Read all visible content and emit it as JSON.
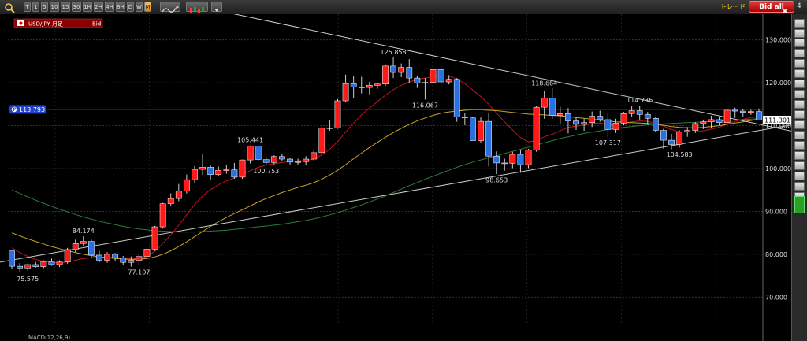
{
  "toolbar": {
    "timeframes": [
      "T",
      "1",
      "5",
      "10",
      "15",
      "30",
      "1H",
      "2H",
      "4H",
      "8H",
      "D",
      "W",
      "M"
    ],
    "active_timeframe": "M",
    "bid_all_label": "Bid all",
    "trend_label": "トレード",
    "side_number": "4"
  },
  "symbol_label": "USD/JPY 月足",
  "price_side": "Bid",
  "bottom_label": "MACD(12,26,9)",
  "colors": {
    "up": "#ff1a1a",
    "down": "#2b6fe0",
    "grid": "#3a3a3a",
    "ma_red": "#c0151d",
    "ma_orange": "#e6a420",
    "ma_green": "#2d7a3a",
    "ma_olive": "#a0a030",
    "trendline": "#cccccc"
  },
  "chart_data": {
    "type": "candlestick",
    "ylim": [
      64,
      136
    ],
    "y_ticks": [
      130,
      120,
      110,
      100,
      90,
      80,
      70
    ],
    "y_tick_labels": [
      "130.000",
      "120.000",
      "110.000",
      "100.000",
      "90.000",
      "80.000",
      "70.000"
    ],
    "current_price_label": "113.793",
    "last_price_label": "111.301",
    "candles": [
      [
        80.8,
        80.8,
        76.5,
        77.2
      ],
      [
        77.2,
        78.0,
        76.0,
        76.8
      ],
      [
        76.8,
        77.9,
        76.2,
        77.6
      ],
      [
        77.6,
        78.2,
        76.9,
        77.1
      ],
      [
        77.1,
        78.6,
        76.8,
        78.3
      ],
      [
        78.3,
        79.0,
        77.3,
        77.6
      ],
      [
        77.6,
        78.6,
        77.0,
        78.2
      ],
      [
        78.2,
        81.5,
        77.8,
        81.1
      ],
      [
        81.1,
        83.4,
        80.5,
        82.5
      ],
      [
        82.5,
        84.2,
        81.9,
        83.0
      ],
      [
        83.0,
        83.4,
        79.2,
        79.8
      ],
      [
        79.8,
        80.8,
        78.1,
        78.6
      ],
      [
        78.6,
        80.5,
        78.0,
        80.0
      ],
      [
        80.0,
        80.3,
        78.5,
        79.1
      ],
      [
        79.1,
        79.6,
        77.4,
        78.1
      ],
      [
        78.1,
        79.5,
        77.1,
        78.6
      ],
      [
        78.6,
        80.1,
        77.5,
        79.5
      ],
      [
        79.5,
        81.9,
        79.0,
        81.2
      ],
      [
        81.2,
        86.6,
        80.8,
        86.4
      ],
      [
        86.4,
        92.0,
        86.0,
        91.8
      ],
      [
        91.8,
        94.2,
        91.3,
        93.0
      ],
      [
        93.0,
        96.4,
        92.4,
        94.8
      ],
      [
        94.8,
        98.6,
        94.2,
        97.4
      ],
      [
        97.4,
        100.6,
        96.7,
        99.8
      ],
      [
        99.8,
        103.5,
        98.5,
        100.3
      ],
      [
        100.3,
        100.7,
        97.4,
        98.6
      ],
      [
        98.6,
        100.5,
        98.3,
        99.6
      ],
      [
        99.6,
        100.9,
        98.8,
        99.7
      ],
      [
        99.7,
        101.3,
        97.6,
        98.0
      ],
      [
        98.0,
        102.1,
        97.6,
        102.0
      ],
      [
        102.0,
        105.4,
        101.2,
        105.2
      ],
      [
        105.2,
        105.4,
        101.7,
        102.1
      ],
      [
        102.1,
        102.8,
        100.8,
        101.4
      ],
      [
        101.4,
        103.1,
        101.0,
        102.8
      ],
      [
        102.8,
        103.5,
        101.8,
        102.2
      ],
      [
        102.2,
        102.5,
        100.9,
        101.5
      ],
      [
        101.5,
        102.3,
        100.9,
        101.6
      ],
      [
        101.6,
        102.9,
        100.9,
        102.2
      ],
      [
        102.2,
        104.3,
        101.8,
        103.7
      ],
      [
        103.7,
        109.8,
        103.3,
        109.4
      ],
      [
        109.4,
        111.2,
        108.8,
        109.5
      ],
      [
        109.5,
        116.2,
        109.3,
        115.8
      ],
      [
        115.8,
        121.9,
        115.5,
        119.8
      ],
      [
        119.8,
        121.6,
        116.4,
        119.0
      ],
      [
        119.0,
        121.4,
        117.5,
        118.9
      ],
      [
        118.9,
        120.2,
        117.3,
        119.4
      ],
      [
        119.4,
        120.0,
        118.6,
        119.7
      ],
      [
        119.7,
        124.3,
        119.2,
        123.9
      ],
      [
        123.9,
        125.9,
        121.1,
        122.4
      ],
      [
        122.4,
        124.5,
        121.3,
        123.6
      ],
      [
        123.6,
        125.5,
        120.0,
        121.1
      ],
      [
        121.1,
        121.7,
        118.8,
        119.9
      ],
      [
        119.9,
        121.1,
        116.1,
        120.1
      ],
      [
        120.1,
        123.6,
        119.9,
        123.1
      ],
      [
        123.1,
        123.9,
        119.0,
        120.2
      ],
      [
        120.2,
        121.8,
        119.6,
        120.8
      ],
      [
        120.8,
        121.1,
        110.9,
        112.0
      ],
      [
        112.0,
        113.0,
        110.1,
        111.8
      ],
      [
        111.8,
        112.1,
        108.3,
        106.5
      ],
      [
        106.5,
        111.9,
        106.0,
        111.0
      ],
      [
        111.0,
        112.9,
        100.5,
        102.9
      ],
      [
        102.9,
        104.0,
        98.7,
        101.3
      ],
      [
        101.3,
        102.3,
        99.5,
        101.2
      ],
      [
        101.2,
        103.9,
        100.1,
        103.3
      ],
      [
        103.3,
        104.3,
        99.0,
        100.9
      ],
      [
        100.9,
        104.6,
        100.1,
        104.3
      ],
      [
        104.3,
        114.6,
        103.9,
        114.3
      ],
      [
        114.3,
        118.0,
        111.6,
        116.4
      ],
      [
        116.4,
        118.7,
        111.6,
        112.4
      ],
      [
        112.4,
        114.4,
        110.3,
        112.8
      ],
      [
        112.8,
        114.1,
        108.2,
        111.1
      ],
      [
        111.1,
        111.9,
        109.0,
        110.3
      ],
      [
        110.3,
        111.6,
        108.8,
        110.7
      ],
      [
        110.7,
        113.3,
        109.7,
        112.2
      ],
      [
        112.2,
        113.5,
        110.9,
        111.4
      ],
      [
        111.4,
        112.8,
        107.3,
        109.1
      ],
      [
        109.1,
        111.6,
        108.3,
        110.6
      ],
      [
        110.6,
        113.2,
        110.1,
        112.8
      ],
      [
        112.8,
        114.5,
        112.0,
        113.5
      ],
      [
        113.5,
        114.7,
        111.4,
        112.6
      ],
      [
        112.6,
        113.2,
        110.2,
        111.7
      ],
      [
        111.7,
        112.0,
        108.5,
        108.9
      ],
      [
        108.9,
        109.3,
        104.6,
        106.6
      ],
      [
        106.6,
        108.1,
        104.5,
        105.6
      ],
      [
        105.6,
        108.9,
        104.9,
        108.6
      ],
      [
        108.6,
        109.7,
        107.4,
        108.9
      ],
      [
        108.9,
        110.8,
        108.3,
        110.5
      ],
      [
        110.5,
        111.4,
        109.2,
        110.9
      ],
      [
        110.9,
        112.3,
        109.5,
        111.4
      ],
      [
        111.4,
        112.0,
        110.1,
        110.7
      ],
      [
        110.7,
        113.9,
        110.4,
        113.6
      ],
      [
        113.6,
        114.2,
        111.8,
        113.4
      ],
      [
        113.4,
        113.9,
        112.0,
        113.1
      ],
      [
        113.1,
        113.7,
        112.5,
        113.3
      ],
      [
        113.3,
        114.0,
        111.6,
        111.3
      ]
    ],
    "annotations": [
      {
        "label": "75.575",
        "index": 2,
        "value": 75.575,
        "pos": "below"
      },
      {
        "label": "84.174",
        "index": 9,
        "value": 84.174,
        "pos": "above"
      },
      {
        "label": "77.107",
        "index": 16,
        "value": 77.107,
        "pos": "below"
      },
      {
        "label": "105.441",
        "index": 30,
        "value": 105.441,
        "pos": "above"
      },
      {
        "label": "100.753",
        "index": 32,
        "value": 100.753,
        "pos": "below"
      },
      {
        "label": "125.858",
        "index": 48,
        "value": 125.858,
        "pos": "above"
      },
      {
        "label": "116.067",
        "index": 52,
        "value": 116.067,
        "pos": "below"
      },
      {
        "label": "98.653",
        "index": 61,
        "value": 98.653,
        "pos": "below"
      },
      {
        "label": "118.664",
        "index": 67,
        "value": 118.664,
        "pos": "above"
      },
      {
        "label": "114.736",
        "index": 79,
        "value": 114.736,
        "pos": "above"
      },
      {
        "label": "107.317",
        "index": 75,
        "value": 107.317,
        "pos": "below"
      },
      {
        "label": "104.583",
        "index": 84,
        "value": 104.583,
        "pos": "below"
      }
    ],
    "ma_series": [
      {
        "color": "#c0151d",
        "values": [
          81.5,
          80.4,
          79.5,
          78.8,
          78.3,
          78.1,
          78.0,
          78.2,
          78.6,
          79.0,
          79.2,
          79.3,
          79.4,
          79.2,
          79.0,
          78.9,
          79.0,
          79.5,
          80.7,
          82.5,
          84.5,
          86.8,
          89.2,
          91.6,
          93.6,
          95.1,
          96.2,
          97.1,
          97.8,
          98.6,
          99.5,
          100.3,
          100.8,
          101.1,
          101.4,
          101.6,
          101.8,
          101.9,
          102.2,
          103.2,
          104.5,
          106.3,
          108.5,
          110.6,
          112.5,
          114.1,
          115.6,
          117.1,
          118.4,
          119.4,
          120.2,
          120.8,
          121.1,
          121.4,
          121.6,
          121.6,
          120.9,
          119.8,
          118.3,
          116.8,
          115.0,
          112.9,
          110.9,
          109.0,
          107.2,
          106.2,
          106.5,
          107.4,
          108.0,
          108.8,
          109.6,
          109.9,
          110.1,
          110.5,
          110.6,
          110.3,
          110.2,
          110.5,
          110.9,
          111.1,
          111.0,
          110.6,
          109.9,
          109.1,
          108.6,
          108.5,
          108.6,
          108.8,
          109.2,
          109.6,
          110.4,
          111.0,
          111.5,
          111.9,
          112.1
        ]
      },
      {
        "color": "#e6a420",
        "values": [
          null,
          null,
          null,
          null,
          null,
          null,
          null,
          null,
          null,
          null,
          null,
          null,
          null,
          null,
          null,
          null,
          null,
          null,
          null,
          null,
          null,
          null,
          null,
          null,
          null,
          null,
          null,
          null,
          null,
          null,
          null,
          null,
          null,
          null,
          null,
          null,
          null,
          null,
          null,
          null,
          null,
          null,
          null,
          null,
          null,
          null,
          null,
          null,
          null,
          null,
          null,
          null,
          null,
          null,
          null,
          null,
          null,
          null,
          null,
          null,
          null,
          null,
          null,
          null,
          null,
          null,
          null,
          null,
          null,
          null,
          null,
          null,
          null,
          null,
          null,
          null,
          null,
          null,
          null,
          null,
          null,
          null,
          null,
          null,
          null,
          null,
          null,
          null,
          null,
          null,
          null,
          null,
          null,
          null,
          null
        ]
      },
      {
        "color": "#2d7a3a",
        "values": [
          95.0,
          94.2,
          93.4,
          92.6,
          91.9,
          91.2,
          90.5,
          89.9,
          89.3,
          88.7,
          88.2,
          87.7,
          87.3,
          86.9,
          86.5,
          86.2,
          85.9,
          85.7,
          85.5,
          85.4,
          85.3,
          85.2,
          85.2,
          85.2,
          85.3,
          85.4,
          85.5,
          85.6,
          85.8,
          86.0,
          86.2,
          86.4,
          86.6,
          86.8,
          87.0,
          87.3,
          87.6,
          87.9,
          88.3,
          88.7,
          89.2,
          89.7,
          90.3,
          90.9,
          91.5,
          92.2,
          92.9,
          93.6,
          94.4,
          95.2,
          96.0,
          96.7,
          97.5,
          98.2,
          98.9,
          99.6,
          100.3,
          100.9,
          101.5,
          102.0,
          102.5,
          103.0,
          103.5,
          104.0,
          104.5,
          105.0,
          105.5,
          106.0,
          106.5,
          107.0,
          107.4,
          107.8,
          108.2,
          108.5,
          108.8,
          109.1,
          109.4,
          109.6,
          109.8,
          110.0,
          110.2,
          110.3,
          110.4,
          110.5,
          110.6,
          110.7,
          110.8,
          110.9,
          111.0,
          111.1,
          111.2,
          111.3,
          111.4,
          111.5,
          111.6
        ]
      },
      {
        "color": "#c9a32a",
        "values": [
          85.0,
          84.3,
          83.6,
          83.0,
          82.4,
          81.8,
          81.3,
          80.8,
          80.4,
          80.0,
          79.7,
          79.4,
          79.2,
          79.0,
          78.9,
          78.8,
          78.8,
          79.0,
          79.4,
          80.0,
          80.8,
          81.8,
          82.9,
          84.1,
          85.3,
          86.5,
          87.6,
          88.6,
          89.5,
          90.4,
          91.3,
          92.2,
          93.0,
          93.7,
          94.4,
          95.0,
          95.6,
          96.1,
          96.7,
          97.5,
          98.5,
          99.6,
          100.9,
          102.3,
          103.6,
          104.9,
          106.1,
          107.3,
          108.4,
          109.4,
          110.3,
          111.1,
          111.8,
          112.4,
          112.9,
          113.2,
          113.4,
          113.6,
          113.7,
          113.7,
          113.6,
          113.5,
          113.3,
          113.1,
          112.9,
          112.7,
          112.6,
          112.5,
          112.4,
          112.3,
          112.1,
          111.9,
          111.7,
          111.5,
          111.3,
          111.1,
          110.9,
          110.8,
          110.7,
          110.6,
          110.5,
          110.3,
          110.1,
          109.8,
          109.6,
          109.5,
          109.5,
          109.6,
          109.8,
          110.0,
          110.3,
          110.6,
          110.9,
          111.2,
          111.5
        ]
      }
    ],
    "trendlines": [
      {
        "x0": -2,
        "y0": 78.0,
        "x1": 100,
        "y1": 110.8
      },
      {
        "x0": 5,
        "y0": 145.0,
        "x1": 100,
        "y1": 108.0
      }
    ]
  }
}
